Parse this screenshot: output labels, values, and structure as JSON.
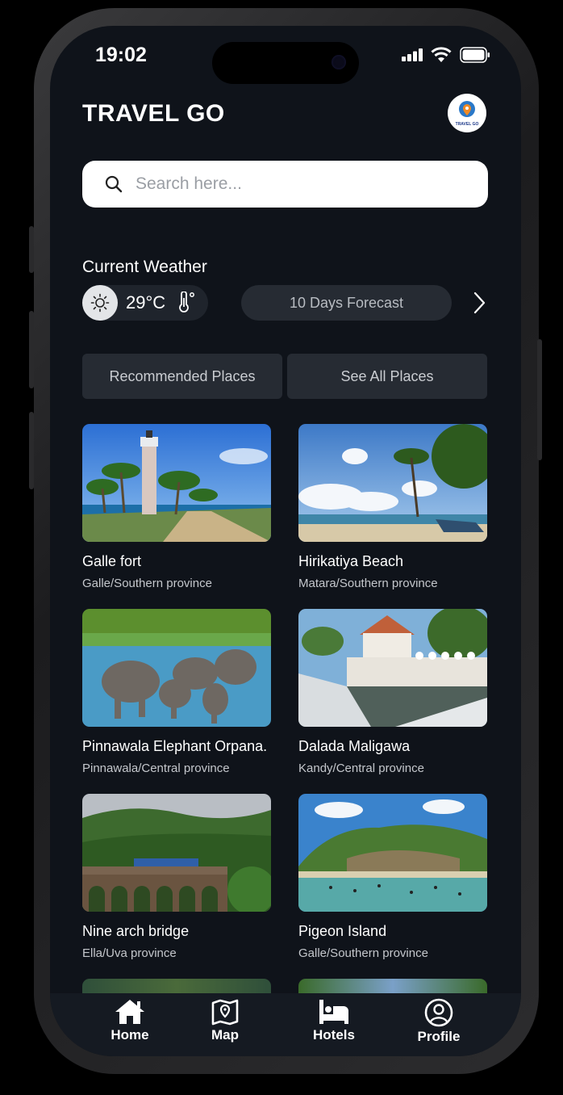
{
  "status_bar": {
    "time": "19:02"
  },
  "app": {
    "title": "TRAVEL GO",
    "logo_text": "TRAVEL GO"
  },
  "search": {
    "placeholder": "Search here..."
  },
  "weather": {
    "title": "Current Weather",
    "temperature": "29°C",
    "forecast_label": "10 Days Forecast"
  },
  "tabs": {
    "recommended": "Recommended Places",
    "see_all": "See All Places"
  },
  "places": [
    {
      "name": "Galle fort",
      "location": "Galle/Southern province"
    },
    {
      "name": "Hirikatiya Beach",
      "location": "Matara/Southern province"
    },
    {
      "name": "Pinnawala Elephant Orpana.",
      "location": "Pinnawala/Central province"
    },
    {
      "name": "Dalada Maligawa",
      "location": "Kandy/Central province"
    },
    {
      "name": "Nine arch bridge",
      "location": "Ella/Uva province"
    },
    {
      "name": "Pigeon Island",
      "location": "Galle/Southern province"
    }
  ],
  "nav": {
    "home": "Home",
    "map": "Map",
    "hotels": "Hotels",
    "profile": "Profile"
  },
  "colors": {
    "screen_bg": "#0f131a",
    "pill_bg": "#262b33",
    "nav_bg": "#151a22"
  }
}
